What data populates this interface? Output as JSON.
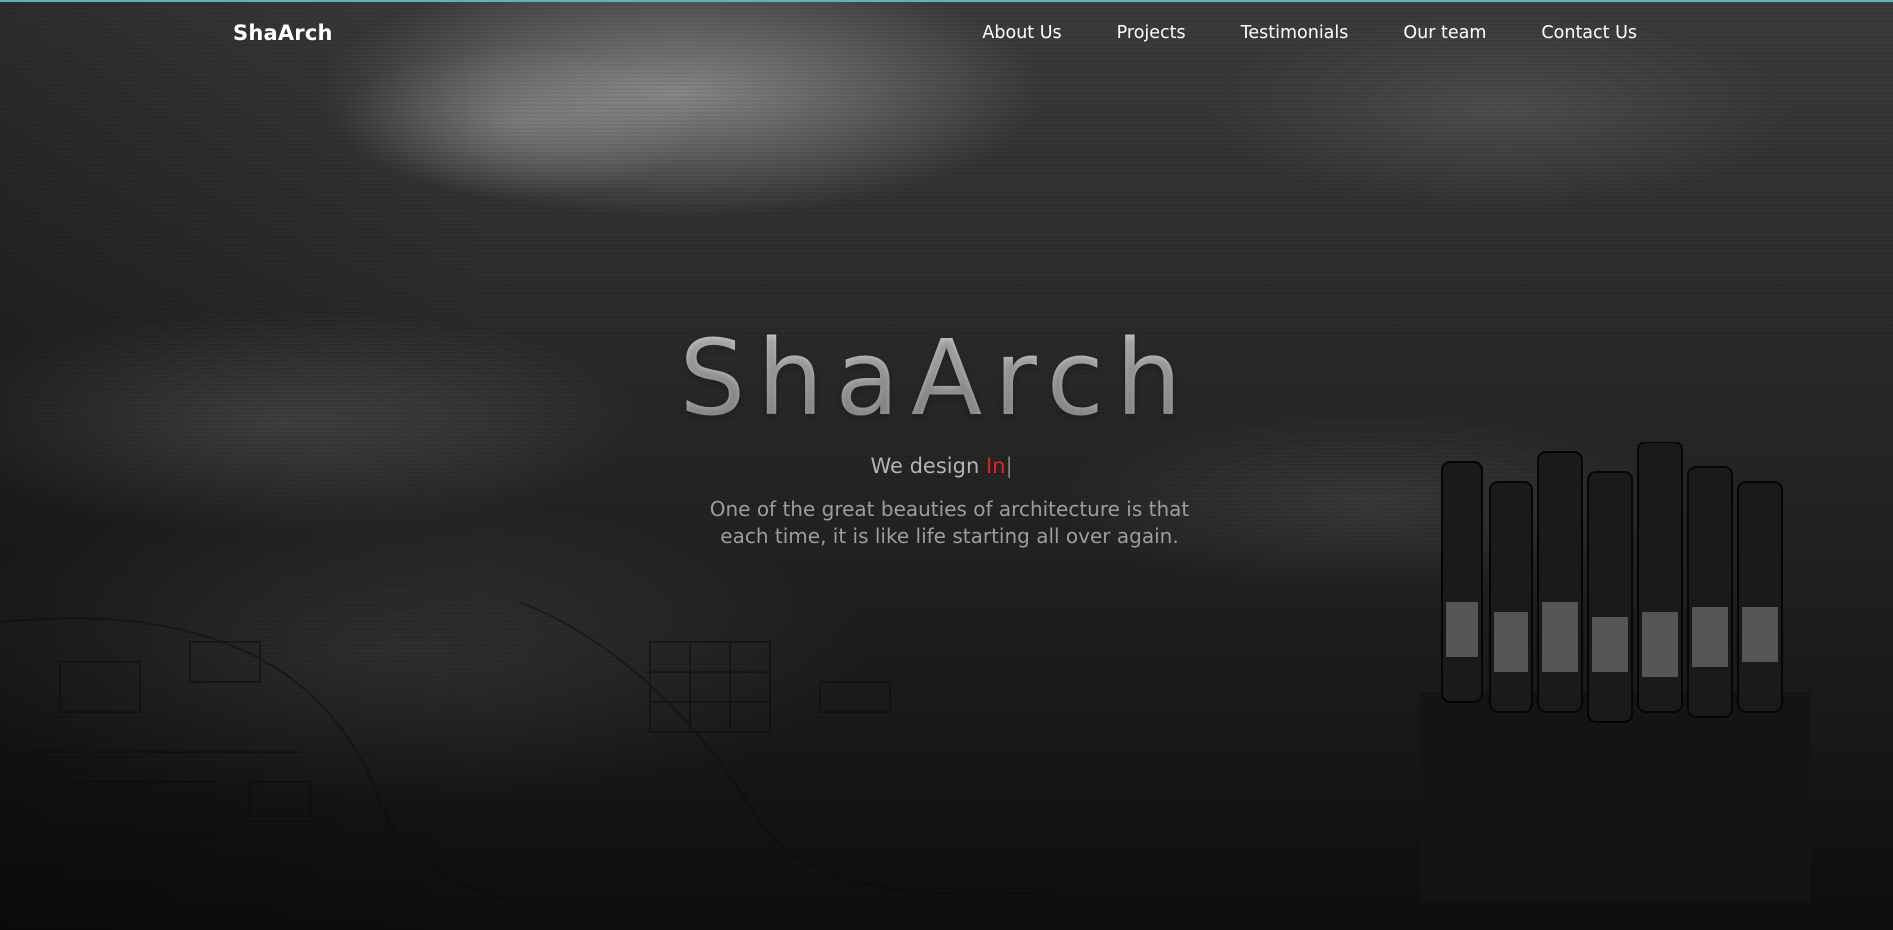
{
  "nav": {
    "brand": "ShaArch",
    "links": [
      {
        "label": "About Us"
      },
      {
        "label": "Projects"
      },
      {
        "label": "Testimonials"
      },
      {
        "label": "Our team"
      },
      {
        "label": "Contact Us"
      }
    ]
  },
  "hero": {
    "title": "ShaArch",
    "subtitle_prefix": "We design",
    "subtitle_typed": "In",
    "cursor": "|",
    "quote_line1": "One of the great beauties of architecture is that",
    "quote_line2": "each time, it is like life starting all over again."
  },
  "colors": {
    "accent": "#d62a2a",
    "top_border": "#5fb3b3",
    "nav_text": "#ffffff",
    "hero_text": "#b3b3b3"
  }
}
